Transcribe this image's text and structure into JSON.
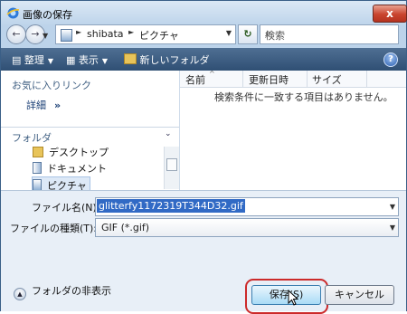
{
  "window": {
    "title": "画像の保存",
    "close_glyph": "x"
  },
  "nav": {
    "back_glyph": "←",
    "forward_glyph": "→",
    "path": [
      "shibata",
      "ピクチャ"
    ],
    "search_placeholder": "検索"
  },
  "toolbar": {
    "organize": "整理",
    "views": "表示",
    "new_folder": "新しいフォルダ",
    "help_glyph": "?"
  },
  "left_pane": {
    "favorites_title": "お気に入りリンク",
    "details": "詳細",
    "folders_title": "フォルダ",
    "tree": [
      {
        "label": "デスクトップ",
        "icon": "folder-icon"
      },
      {
        "label": "ドキュメント",
        "icon": "documents-icon"
      },
      {
        "label": "ピクチャ",
        "icon": "pictures-icon"
      }
    ]
  },
  "file_list": {
    "columns": [
      "名前",
      "更新日時",
      "サイズ"
    ],
    "empty_message": "検索条件に一致する項目はありません。"
  },
  "form": {
    "filename_label": "ファイル名(N):",
    "filename_value": "glitterfy1172319T344D32.gif",
    "filetype_label": "ファイルの種類(T):",
    "filetype_value": "GIF (*.gif)"
  },
  "footer": {
    "hide_folders": "フォルダの非表示",
    "save_button": "保存(S)",
    "cancel_button": "キャンセル"
  },
  "colors": {
    "toolbar": "#2f4f74",
    "highlight": "#cc2a2a",
    "selection": "#316ac5"
  }
}
